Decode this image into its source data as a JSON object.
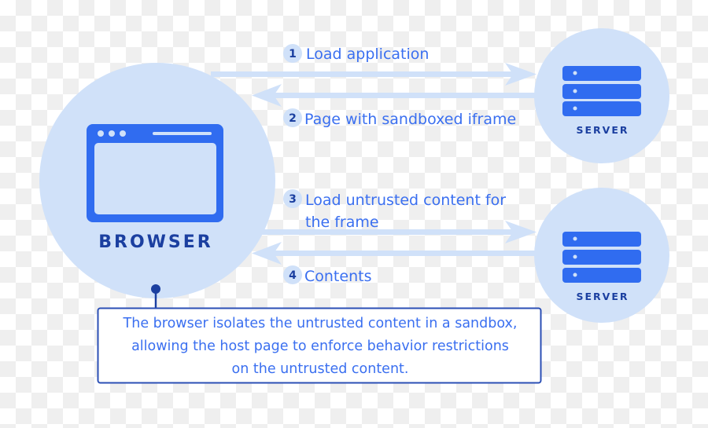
{
  "colors": {
    "light": "#d0e1f9",
    "accent": "#306cf0",
    "dark": "#1b3fa0"
  },
  "browser": {
    "label": "BROWSER",
    "icon": "browser-window-icon"
  },
  "servers": [
    {
      "label": "SERVER",
      "icon": "server-icon"
    },
    {
      "label": "SERVER",
      "icon": "server-icon"
    }
  ],
  "steps": [
    {
      "num": "1",
      "lines": [
        "Load application"
      ]
    },
    {
      "num": "2",
      "lines": [
        "Page with sandboxed iframe"
      ]
    },
    {
      "num": "3",
      "lines": [
        "Load untrusted content for",
        "the frame"
      ]
    },
    {
      "num": "4",
      "lines": [
        "Contents"
      ]
    }
  ],
  "note": {
    "lines": [
      "The browser isolates the untrusted content in a sandbox,",
      "allowing the host page to enforce behavior restrictions",
      "on the untrusted content."
    ]
  }
}
